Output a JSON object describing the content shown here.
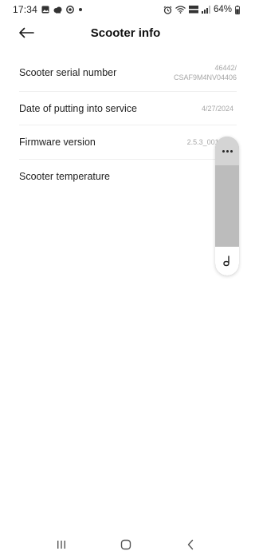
{
  "status_bar": {
    "time": "17:34",
    "left_icons": [
      "gallery-icon",
      "cloud-icon",
      "record-icon",
      "dot-icon"
    ],
    "right_icons": [
      "alarm-icon",
      "wifi-icon",
      "volte-icon",
      "signal-icon",
      "battery-icon"
    ],
    "battery": "64%"
  },
  "header": {
    "title": "Scooter info"
  },
  "info_rows": [
    {
      "label": "Scooter serial number",
      "value_line1": "46442/",
      "value_line2": "CSAF9M4NV04406"
    },
    {
      "label": "Date of putting into service",
      "value": "4/27/2024"
    },
    {
      "label": "Firmware version",
      "value": "2.5.3_0011"
    },
    {
      "label": "Scooter temperature",
      "value": ""
    }
  ],
  "floating_panel": {
    "icons": [
      "more-dots-icon",
      "pen-assist-icon"
    ]
  },
  "nav_bar": {
    "icons": [
      "recent-apps-icon",
      "home-icon",
      "back-icon"
    ]
  },
  "colors": {
    "background": "#ffffff",
    "text": "#222222",
    "muted": "#a6a6a6",
    "panel": "#bdbdbd"
  }
}
